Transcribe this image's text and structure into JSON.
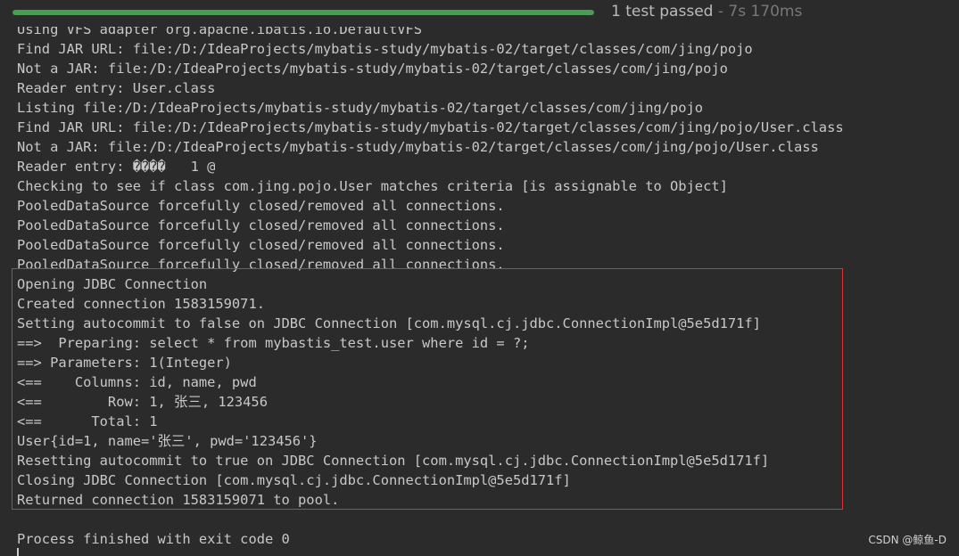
{
  "test_status": {
    "progress_fraction": 1.0,
    "result": "1 test passed",
    "duration": " - 7s 170ms"
  },
  "console": {
    "lines": [
      "Using VFS adapter org.apache.ibatis.io.DefaultVFS",
      "Find JAR URL: file:/D:/IdeaProjects/mybatis-study/mybatis-02/target/classes/com/jing/pojo",
      "Not a JAR: file:/D:/IdeaProjects/mybatis-study/mybatis-02/target/classes/com/jing/pojo",
      "Reader entry: User.class",
      "Listing file:/D:/IdeaProjects/mybatis-study/mybatis-02/target/classes/com/jing/pojo",
      "Find JAR URL: file:/D:/IdeaProjects/mybatis-study/mybatis-02/target/classes/com/jing/pojo/User.class",
      "Not a JAR: file:/D:/IdeaProjects/mybatis-study/mybatis-02/target/classes/com/jing/pojo/User.class",
      "Reader entry: ����   1 @",
      "Checking to see if class com.jing.pojo.User matches criteria [is assignable to Object]",
      "PooledDataSource forcefully closed/removed all connections.",
      "PooledDataSource forcefully closed/removed all connections.",
      "PooledDataSource forcefully closed/removed all connections.",
      "PooledDataSource forcefully closed/removed all connections.",
      "Opening JDBC Connection",
      "Created connection 1583159071.",
      "Setting autocommit to false on JDBC Connection [com.mysql.cj.jdbc.ConnectionImpl@5e5d171f]",
      "==>  Preparing: select * from mybastis_test.user where id = ?;",
      "==> Parameters: 1(Integer)",
      "<==    Columns: id, name, pwd",
      "<==        Row: 1, 张三, 123456",
      "<==      Total: 1",
      "User{id=1, name='张三', pwd='123456'}",
      "Resetting autocommit to true on JDBC Connection [com.mysql.cj.jdbc.ConnectionImpl@5e5d171f]",
      "Closing JDBC Connection [com.mysql.cj.jdbc.ConnectionImpl@5e5d171f]",
      "Returned connection 1583159071 to pool.",
      "",
      "Process finished with exit code 0"
    ]
  },
  "watermark": "CSDN @鲸鱼-D",
  "colors": {
    "background": "#2b2b2b",
    "text": "#c8c8c8",
    "progress": "#499c54",
    "highlight_border": "#e0313a"
  }
}
